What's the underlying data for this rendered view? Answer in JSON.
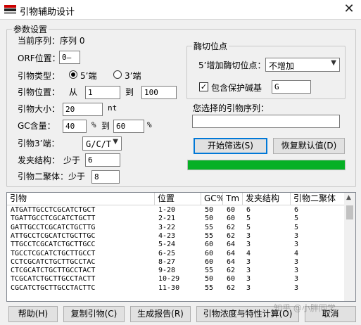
{
  "window": {
    "title": "引物辅助设计",
    "close_glyph": "✕"
  },
  "params": {
    "group_title": "参数设置",
    "current_seq_label": "当前序列：序列 0",
    "orf_label": "ORF位置：",
    "orf_value": "0—",
    "primer_type_label": "引物类型：",
    "primer_type_options": [
      "5’端",
      "3’端"
    ],
    "position_label": "引物位置：",
    "from_label": "从",
    "from_value": "1",
    "to_label": "到",
    "to_value": "100",
    "size_label": "引物大小：",
    "size_value": "20",
    "size_unit": "nt",
    "gc_label": "GC含量：",
    "gc_min": "40",
    "gc_pct1": "%",
    "gc_to": "到",
    "gc_max": "60",
    "gc_pct2": "%",
    "end3_label": "引物3’端：",
    "end3_value": "G/C/T",
    "hairpin_label": "发夹结构：",
    "hairpin_less": "少于",
    "hairpin_value": "6",
    "dimer_label": "引物二聚体：",
    "dimer_less": "少于",
    "dimer_value": "8"
  },
  "enzyme": {
    "group_title": "酶切位点",
    "add_site_label": "5’增加酶切位点：",
    "add_site_value": "不增加",
    "protect_label": "包含保护碱基",
    "protect_checked": true,
    "check_glyph": "✓",
    "protect_value": "G",
    "selected_seq_label": "您选择的引物序列：",
    "selected_seq_value": ""
  },
  "actions": {
    "start_filter": "开始筛选(S)",
    "restore_defaults": "恢复默认值(D)"
  },
  "progress": {
    "fraction": 1.0,
    "color": "#06b025"
  },
  "table": {
    "columns": [
      "引物",
      "位置",
      "GC%",
      "Tm",
      "发夹结构",
      "引物二聚体"
    ],
    "rows": [
      [
        "ATGATTGCCTCGCATCTGCT",
        "1-20",
        "50",
        "60",
        "6",
        "6"
      ],
      [
        "TGATTGCCTCGCATCTGCTT",
        "2-21",
        "50",
        "60",
        "5",
        "5"
      ],
      [
        "GATTGCCTCGCATCTGCTTG",
        "3-22",
        "55",
        "62",
        "5",
        "5"
      ],
      [
        "ATTGCCTCGCATCTGCTTGC",
        "4-23",
        "55",
        "62",
        "3",
        "3"
      ],
      [
        "TTGCCTCGCATCTGCTTGCC",
        "5-24",
        "60",
        "64",
        "3",
        "3"
      ],
      [
        "TGCCTCGCATCTGCTTGCCT",
        "6-25",
        "60",
        "64",
        "4",
        "4"
      ],
      [
        "CCTCGCATCTGCTTGCCTAC",
        "8-27",
        "60",
        "64",
        "3",
        "3"
      ],
      [
        "CTCGCATCTGCTTGCCTACT",
        "9-28",
        "55",
        "62",
        "3",
        "3"
      ],
      [
        "TCGCATCTGCTTGCCTACTT",
        "10-29",
        "50",
        "60",
        "3",
        "3"
      ],
      [
        "CGCATCTGCTTGCCTACTTC",
        "11-30",
        "55",
        "62",
        "3",
        "3"
      ]
    ]
  },
  "bottom": {
    "help": "帮助(H)",
    "copy": "复制引物(C)",
    "report": "生成报告(R)",
    "calc": "引物浓度与特性计算(O)",
    "cancel": "取消"
  },
  "watermark": "知乎 @小胖同学"
}
